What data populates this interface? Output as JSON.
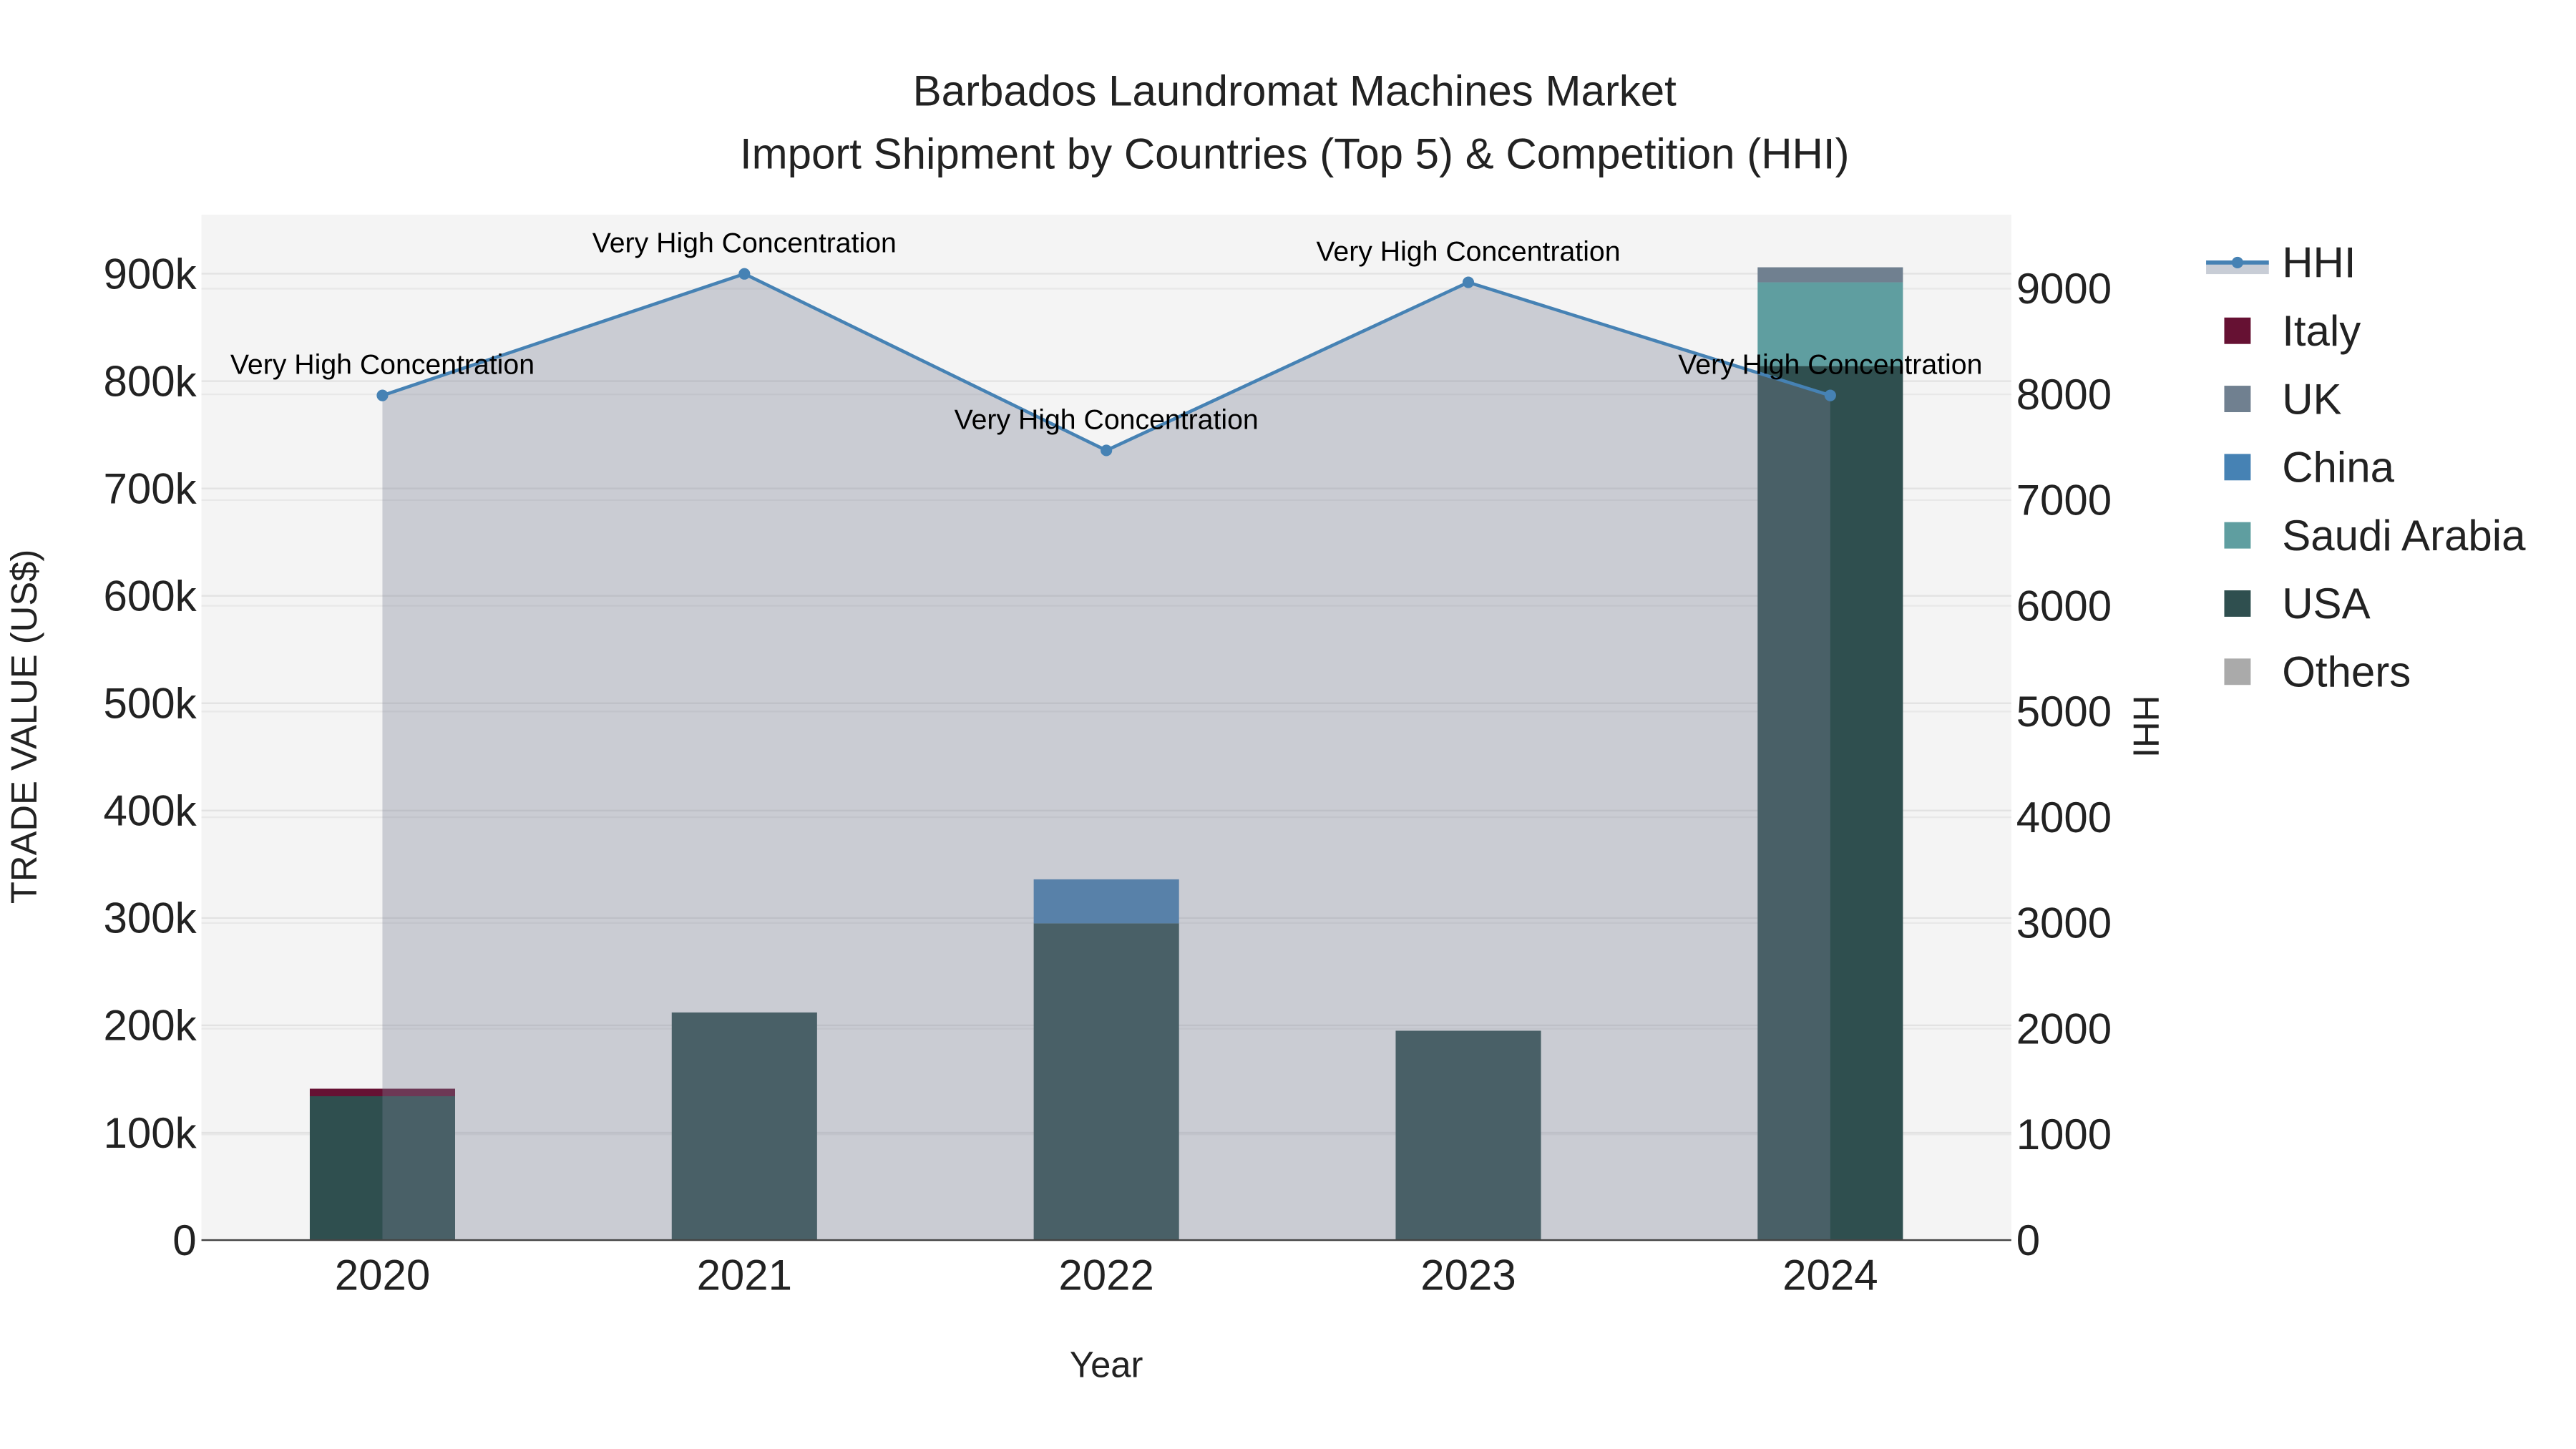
{
  "chart_data": {
    "type": "bar",
    "title": "Barbados Laundromat Machines Market",
    "subtitle": "Import Shipment by Countries (Top 5) & Competition (HHI)",
    "xlabel": "Year",
    "ylabel": "TRADE VALUE (US$)",
    "y2label": "HHI",
    "categories": [
      "2020",
      "2021",
      "2022",
      "2023",
      "2024"
    ],
    "ylim": [
      0,
      955000
    ],
    "y2lim": [
      0,
      9700
    ],
    "yticks": [
      0,
      100000,
      200000,
      300000,
      400000,
      500000,
      600000,
      700000,
      800000,
      900000
    ],
    "yticklabels": [
      "0",
      "100k",
      "200k",
      "300k",
      "400k",
      "500k",
      "600k",
      "700k",
      "800k",
      "900k"
    ],
    "y2ticks": [
      0,
      1000,
      2000,
      3000,
      4000,
      5000,
      6000,
      7000,
      8000,
      9000
    ],
    "y2ticklabels": [
      "0",
      "1000",
      "2000",
      "3000",
      "4000",
      "5000",
      "6000",
      "7000",
      "8000",
      "9000"
    ],
    "legend_position": "right",
    "series": [
      {
        "name": "USA",
        "color": "#2f4f4f",
        "values": [
          134000,
          212000,
          295000,
          195000,
          814000
        ]
      },
      {
        "name": "Saudi Arabia",
        "color": "#5f9ea0",
        "values": [
          0,
          0,
          0,
          0,
          78000
        ]
      },
      {
        "name": "China",
        "color": "#4682b4",
        "values": [
          0,
          0,
          41000,
          0,
          0
        ]
      },
      {
        "name": "UK",
        "color": "#708090",
        "values": [
          0,
          0,
          0,
          0,
          14000
        ]
      },
      {
        "name": "Italy",
        "color": "#661133",
        "values": [
          7000,
          0,
          0,
          0,
          0
        ]
      },
      {
        "name": "Others",
        "color": "#aaaaaa",
        "values": [
          0,
          0,
          0,
          0,
          0
        ]
      }
    ],
    "hhi": {
      "name": "HHI",
      "color": "#4682b4",
      "values": [
        7990,
        9140,
        7470,
        9060,
        7990
      ],
      "annotations": [
        "Very High Concentration",
        "Very High Concentration",
        "Very High Concentration",
        "Very High Concentration",
        "Very High Concentration"
      ]
    },
    "legend_order": [
      "HHI",
      "Italy",
      "UK",
      "China",
      "Saudi Arabia",
      "USA",
      "Others"
    ]
  }
}
